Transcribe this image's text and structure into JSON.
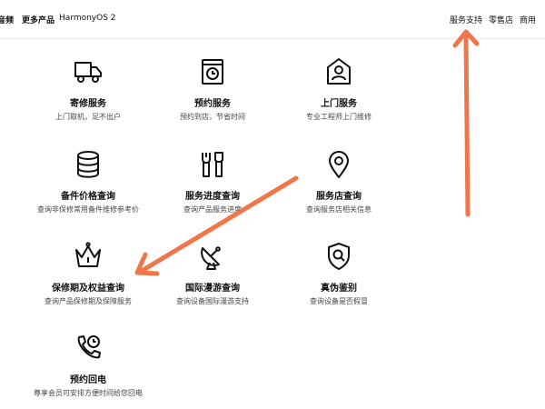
{
  "nav": {
    "left": [
      "音频",
      "更多产品",
      "HarmonyOS 2"
    ],
    "right": [
      "服务支持",
      "零售店",
      "商用"
    ]
  },
  "services": [
    {
      "title": "寄修服务",
      "desc": "上门取机，足不出户",
      "icon": "truck-icon"
    },
    {
      "title": "预约服务",
      "desc": "预约到店，节省时间",
      "icon": "calendar-clock-icon"
    },
    {
      "title": "上门服务",
      "desc": "专业工程师上门维修",
      "icon": "engineer-icon"
    },
    {
      "title": "备件价格查询",
      "desc": "查询非保修常用备件维修参考价",
      "icon": "database-icon"
    },
    {
      "title": "服务进度查询",
      "desc": "查询产品服务进度",
      "icon": "tools-icon"
    },
    {
      "title": "服务店查询",
      "desc": "查询服务店相关信息",
      "icon": "location-pin-icon"
    },
    {
      "title": "保修期及权益查询",
      "desc": "查询产品保修期及保障服务",
      "icon": "crown-icon"
    },
    {
      "title": "国际漫游查询",
      "desc": "查询设备国际漫游支持",
      "icon": "satellite-dish-icon"
    },
    {
      "title": "真伪鉴别",
      "desc": "查询设备是否假冒",
      "icon": "shield-search-icon"
    },
    {
      "title": "预约回电",
      "desc": "尊享会员可安排方便时间给您回电",
      "icon": "phone-clock-icon"
    }
  ],
  "colors": {
    "arrow": "#f0764a",
    "text": "#111111",
    "muted": "#444444"
  }
}
